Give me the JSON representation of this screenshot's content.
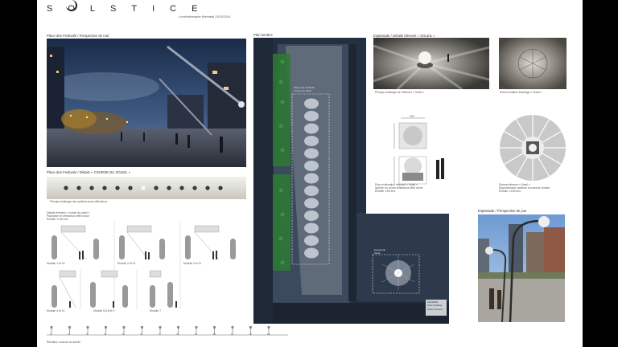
{
  "header": {
    "title": "SOLSTICE",
    "subtitle": "Luminothérapie Montréal 2013/2014"
  },
  "captions": {
    "night": "Place des Festivals / Perspective de nuit",
    "plan": "Plan lumière",
    "esplanade_details": "Esplanade / Détails élément « SOLEIL »",
    "course": "Place des Festivals / Détails « COURSE DU SOLEIL »",
    "day": "Esplanade / Perspective de jour",
    "principle": "Principe éclairage des sphères avec réflecteurs",
    "element_detail": "Détails élément « course du soleil »\nPlafonnier et réflecteurs effet miroir\nÉchelle 1:100 env.",
    "elevation": "Élévation «course du soleil»",
    "soleil_principle": "Principe éclairage de l'élément « Soleil »",
    "ceiling_shape": "Shéma relation éclairage « Soleil »",
    "plan_elevation": "Plan et élévation élément « Soleil »\nSphère en Lexan réflecteurs effet miroir\nÉchelle 1:50 env.",
    "soleil_shape": "Shéma élément « Soleil »\nRayonnement cadencé en tranche horaire\nÉchelle 1:100 env.",
    "dim_200": "200"
  },
  "modules": [
    "Module 1 et 13",
    "Module 2 et 12",
    "Module 3 et 11",
    "Module 4 et 10",
    "Module 5,6,8 et 9",
    "Module 7"
  ],
  "scale_numbers": [
    "1",
    "2",
    "3",
    "4",
    "5",
    "6",
    "7",
    "8",
    "9",
    "10",
    "11",
    "12",
    "13"
  ],
  "plan_labels": {
    "place": "Place des Festivals\nCourse du Soleil",
    "esplanade": "Esplanade\nSoleil",
    "legend_title": "LÉGENDE",
    "legend_1": "Spots d'éclairage",
    "legend_2": "Sphère lumineuse"
  },
  "colors": {
    "night_sky": "#2c3f60",
    "plan_bg": "#243041",
    "grass": "#2e7a34"
  },
  "chart_data": null
}
